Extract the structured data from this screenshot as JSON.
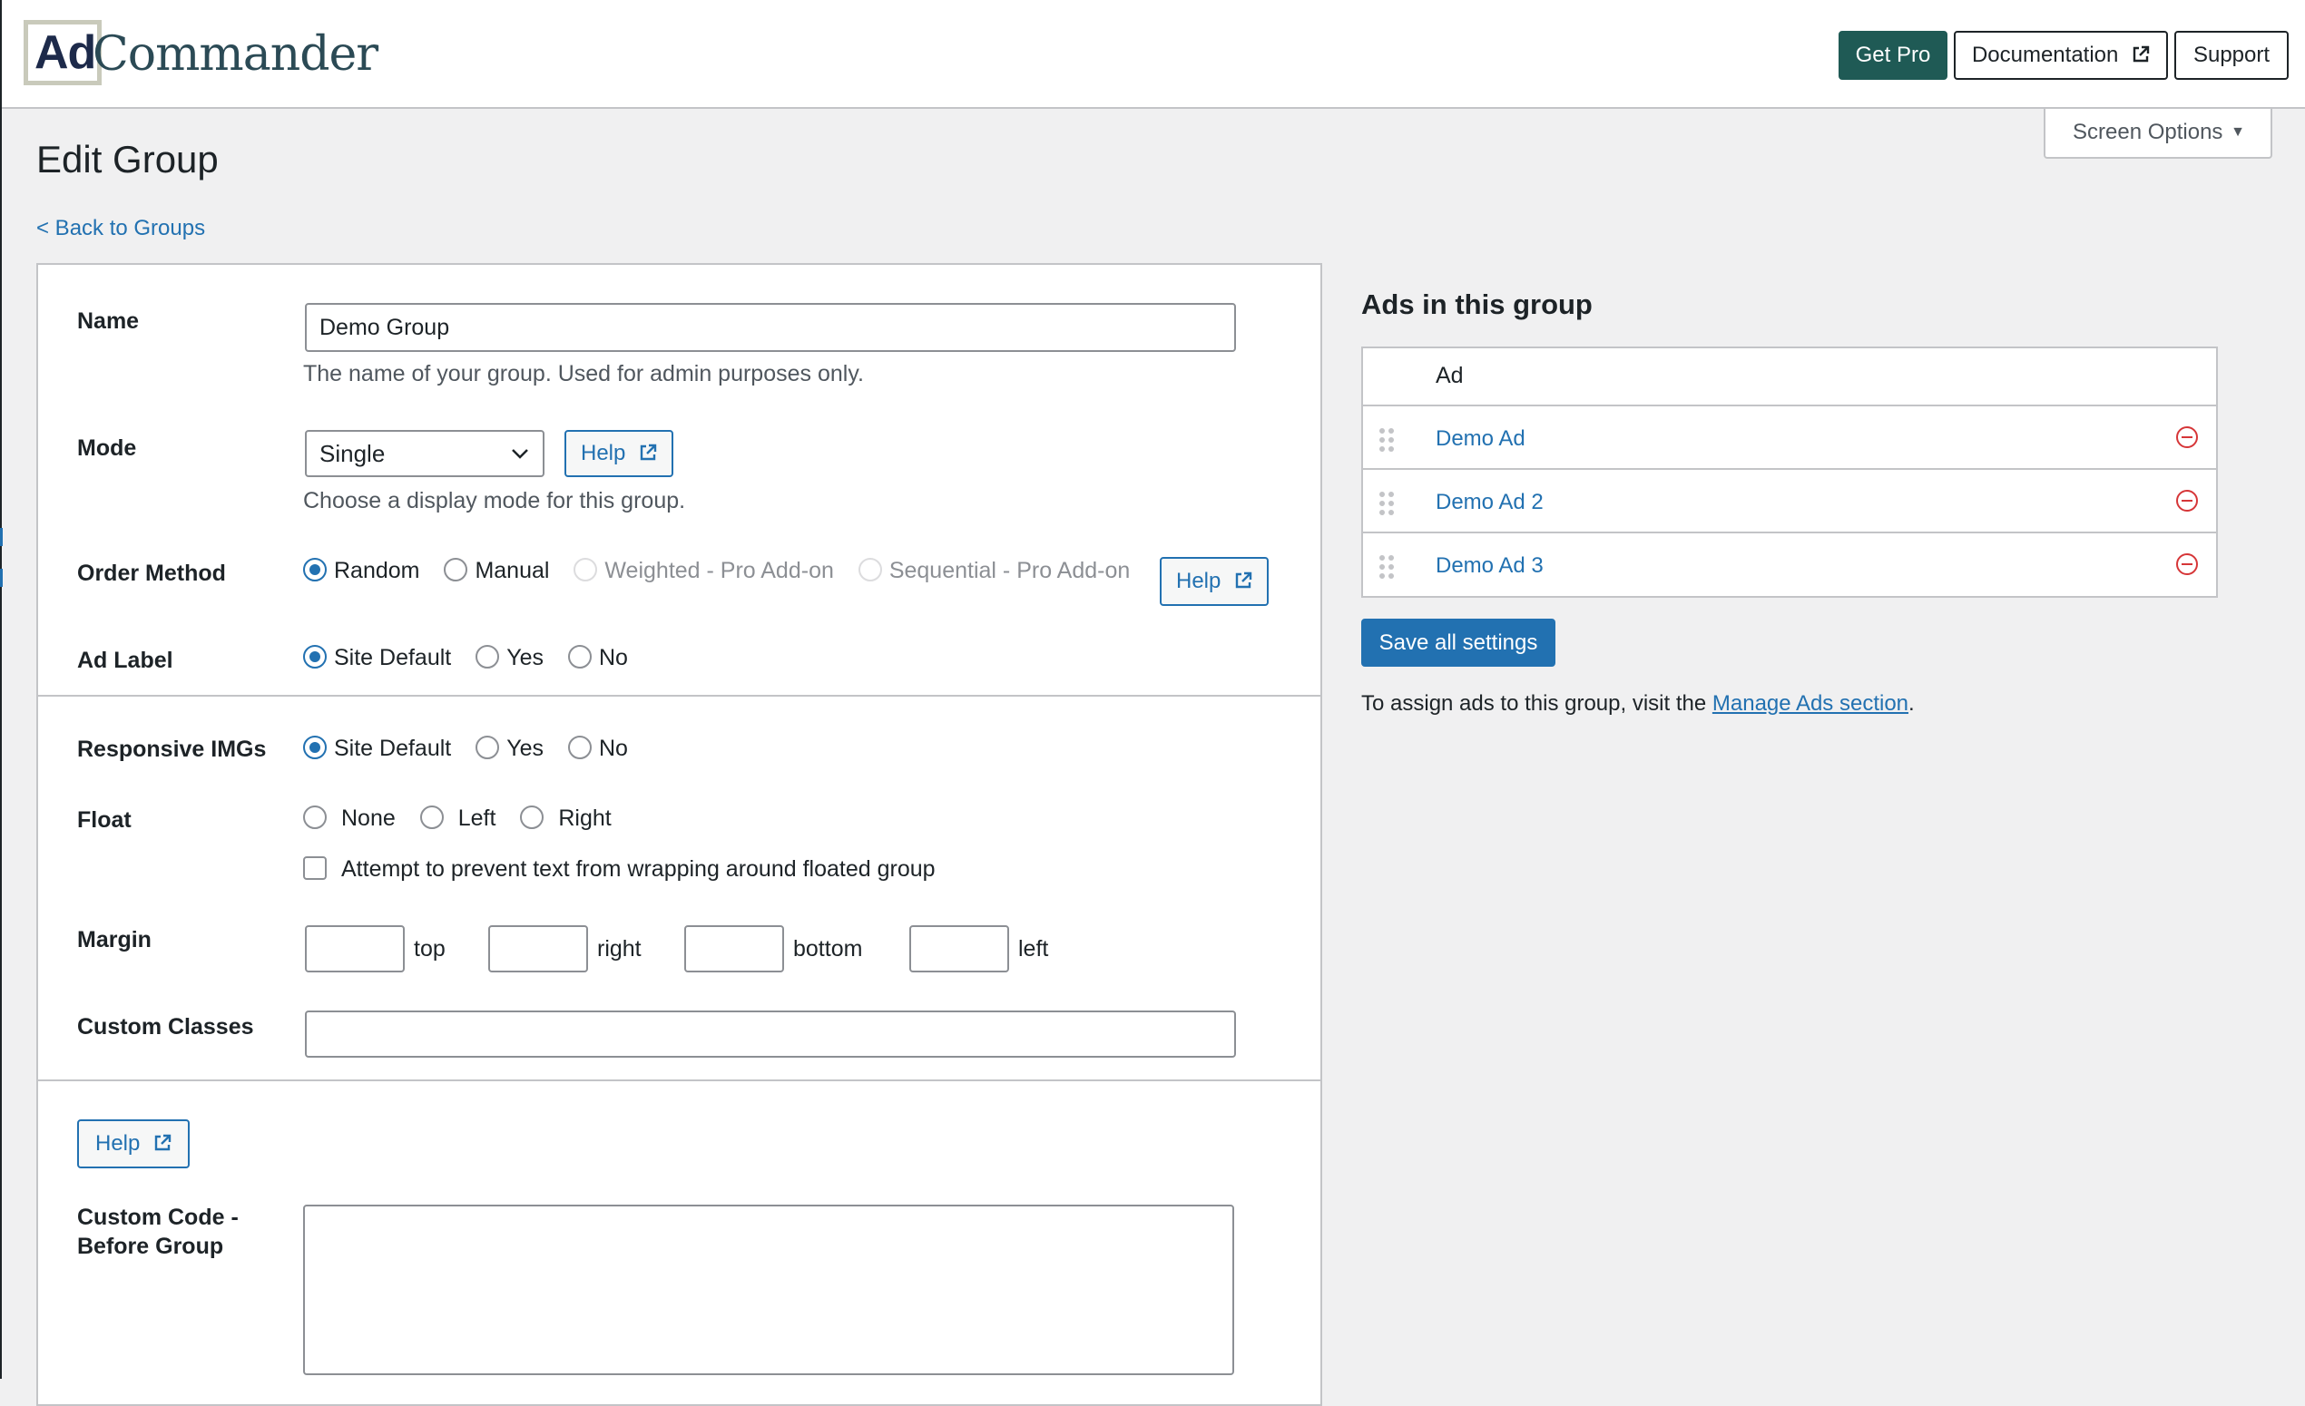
{
  "header": {
    "logo_ad": "Ad",
    "logo_commander": "Commander",
    "get_pro": "Get Pro",
    "documentation": "Documentation",
    "support": "Support"
  },
  "screen_options": "Screen Options",
  "page_title": "Edit Group",
  "back_link": "< Back to Groups",
  "form": {
    "name": {
      "label": "Name",
      "value": "Demo Group",
      "description": "The name of your group. Used for admin purposes only."
    },
    "mode": {
      "label": "Mode",
      "selected": "Single",
      "help": "Help",
      "description": "Choose a display mode for this group."
    },
    "order_method": {
      "label": "Order Method",
      "options": [
        "Random",
        "Manual",
        "Weighted - Pro Add-on",
        "Sequential - Pro Add-on"
      ],
      "selected": "Random",
      "help": "Help"
    },
    "ad_label": {
      "label": "Ad Label",
      "options": [
        "Site Default",
        "Yes",
        "No"
      ],
      "selected": "Site Default"
    },
    "responsive_imgs": {
      "label": "Responsive IMGs",
      "options": [
        "Site Default",
        "Yes",
        "No"
      ],
      "selected": "Site Default"
    },
    "float": {
      "label": "Float",
      "options": [
        "None",
        "Left",
        "Right"
      ],
      "checkbox_label": "Attempt to prevent text from wrapping around floated group"
    },
    "margin": {
      "label": "Margin",
      "top": "top",
      "right": "right",
      "bottom": "bottom",
      "left": "left"
    },
    "custom_classes": {
      "label": "Custom Classes",
      "value": ""
    },
    "code_help": "Help",
    "custom_code_before": {
      "label_line1": "Custom Code -",
      "label_line2": "Before Group",
      "value": ""
    }
  },
  "ads_panel": {
    "title": "Ads in this group",
    "column_header": "Ad",
    "ads": [
      "Demo Ad",
      "Demo Ad 2",
      "Demo Ad 3"
    ],
    "save_button": "Save all settings",
    "assign_text": "To assign ads to this group, visit the ",
    "assign_link": "Manage Ads section",
    "assign_end": "."
  },
  "colors": {
    "accent": "#2271b1",
    "pro_button": "#1f5a55",
    "remove_icon": "#d63638",
    "background": "#f0f0f1"
  }
}
